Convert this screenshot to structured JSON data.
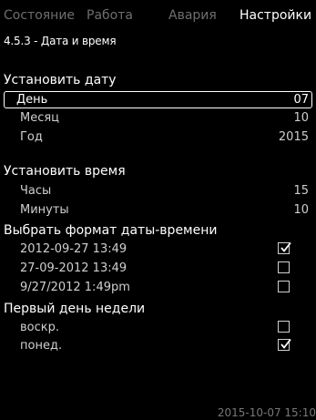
{
  "tabs": [
    {
      "label": "Состояние",
      "active": false
    },
    {
      "label": "Работа",
      "active": false
    },
    {
      "label": "Авария",
      "active": false
    },
    {
      "label": "Настройки",
      "active": true
    }
  ],
  "breadcrumb": "4.5.3 - Дата и время",
  "set_date": {
    "heading": "Установить дату",
    "items": [
      {
        "label": "День",
        "value": "07",
        "selected": true
      },
      {
        "label": "Месяц",
        "value": "10"
      },
      {
        "label": "Год",
        "value": "2015"
      }
    ]
  },
  "set_time": {
    "heading": "Установить время",
    "items": [
      {
        "label": "Часы",
        "value": "15"
      },
      {
        "label": "Минуты",
        "value": "10"
      }
    ]
  },
  "format": {
    "heading": "Выбрать формат даты-времени",
    "options": [
      {
        "label": "2012-09-27  13:49",
        "checked": true
      },
      {
        "label": "27-09-2012  13:49",
        "checked": false
      },
      {
        "label": "9/27/2012  1:49pm",
        "checked": false
      }
    ]
  },
  "first_day": {
    "heading": "Первый день недели",
    "options": [
      {
        "label": "воскр.",
        "checked": false
      },
      {
        "label": "понед.",
        "checked": true
      }
    ]
  },
  "footer": {
    "datetime": "2015-10-07  15:10"
  },
  "colors": {
    "background": "#000000",
    "text": "#ffffff",
    "inactive": "#6e6e6e"
  }
}
